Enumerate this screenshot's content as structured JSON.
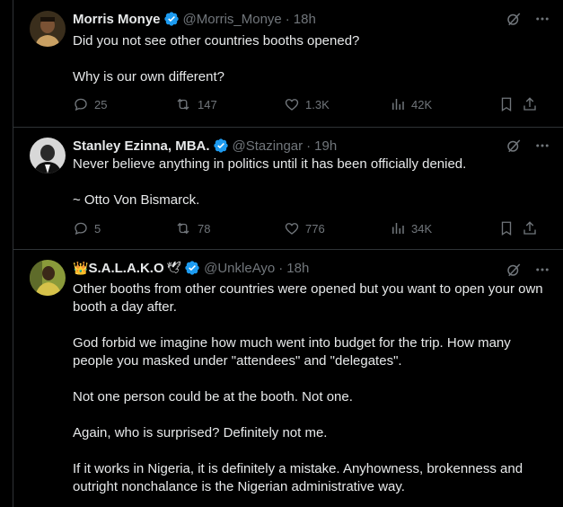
{
  "tweets": [
    {
      "name": "Morris Monye",
      "handle": "@Morris_Monye",
      "time": "18h",
      "paragraphs": [
        "Did you not see other countries booths opened?",
        "Why is our own different?"
      ],
      "replies": "25",
      "reposts": "147",
      "likes": "1.3K",
      "views": "42K"
    },
    {
      "name": "Stanley Ezinna, MBA.",
      "handle": "@Stazingar",
      "time": "19h",
      "paragraphs": [
        "Never believe anything in politics until it has been officially denied.",
        "~ Otto Von Bismarck."
      ],
      "replies": "5",
      "reposts": "78",
      "likes": "776",
      "views": "34K"
    },
    {
      "name_prefix_emoji": "👑",
      "name": "S.A.L.A.K.O",
      "name_suffix_emoji": "🕊",
      "handle": "@UnkleAyo",
      "time": "18h",
      "paragraphs": [
        "Other booths from other countries were opened but you want to open your own booth a day after.",
        "God forbid we imagine how much went into budget for the trip. How many people you masked under \"attendees\" and \"delegates\".",
        "Not one person could be at the booth. Not one.",
        "Again, who is surprised? Definitely not me.",
        "If it works in Nigeria, it is definitely a mistake. Anyhowness, brokenness and outright nonchalance is the Nigerian administrative way."
      ]
    }
  ],
  "colors": {
    "background": "#000000",
    "text": "#e7e9ea",
    "muted": "#71767b",
    "border": "#2f3336",
    "verified": "#1d9bf0"
  },
  "icons": [
    "grok-icon",
    "more-icon",
    "reply-icon",
    "repost-icon",
    "like-icon",
    "views-icon",
    "bookmark-icon",
    "share-icon",
    "verified-badge-icon"
  ]
}
